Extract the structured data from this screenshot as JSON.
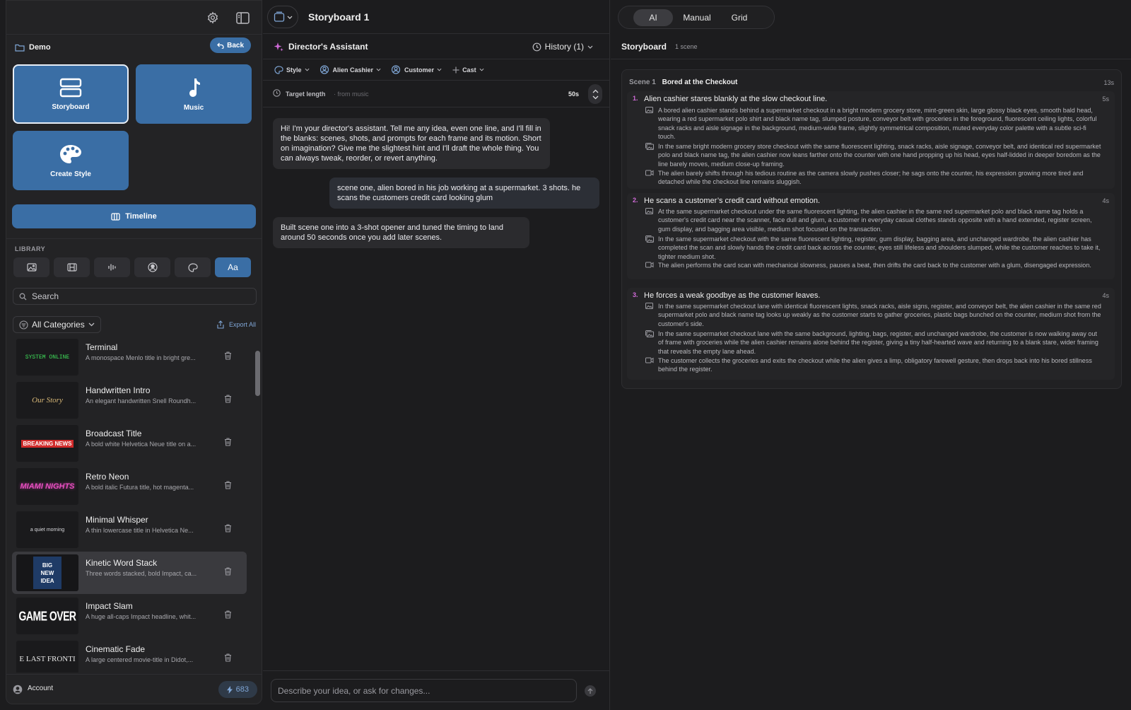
{
  "left": {
    "project_name": "Demo",
    "back_label": "Back",
    "tiles": {
      "storyboard": "Storyboard",
      "music": "Music",
      "create_style": "Create Style"
    },
    "timeline_label": "Timeline",
    "library_title": "LIBRARY",
    "library_tabs": [
      "image",
      "film",
      "audio",
      "character",
      "palette",
      "Aa"
    ],
    "search_placeholder": "Search",
    "categories_label": "All Categories",
    "export_label": "Export All",
    "items": [
      {
        "title": "Terminal",
        "desc": "A monospace Menlo title in bright gre...",
        "thumb": "SYSTEM ONLINE"
      },
      {
        "title": "Handwritten Intro",
        "desc": "An elegant handwritten Snell Roundh...",
        "thumb": "Our Story"
      },
      {
        "title": "Broadcast Title",
        "desc": "A bold white Helvetica Neue title on a...",
        "thumb": "BREAKING NEWS"
      },
      {
        "title": "Retro Neon",
        "desc": "A bold italic Futura title, hot magenta...",
        "thumb": "MIAMI NIGHTS"
      },
      {
        "title": "Minimal Whisper",
        "desc": "A thin lowercase title in Helvetica Ne...",
        "thumb": "a quiet morning"
      },
      {
        "title": "Kinetic Word Stack",
        "desc": "Three words stacked, bold Impact, ca...",
        "thumb": [
          "BIG",
          "NEW",
          "IDEA"
        ]
      },
      {
        "title": "Impact Slam",
        "desc": "A huge all-caps Impact headline, whit...",
        "thumb": "GAME OVER"
      },
      {
        "title": "Cinematic Fade",
        "desc": "A large centered movie-title in Didot,...",
        "thumb": "E LAST FRONTI"
      }
    ],
    "account_label": "Account",
    "credits": "683"
  },
  "middle": {
    "board_title": "Storyboard 1",
    "assistant_title": "Director's Assistant",
    "history_label": "History (1)",
    "chips": [
      "Style",
      "Alien Cashier",
      "Customer",
      "Cast"
    ],
    "target_label": "Target length",
    "target_from": "· from music",
    "target_value": "50s",
    "messages": [
      {
        "role": "assistant",
        "text": "Hi! I'm your director's assistant. Tell me any idea, even one line, and I'll fill in the blanks: scenes, shots, and prompts for each frame and its motion. Short on imagination? Give me the slightest hint and I'll draft the whole thing. You can always tweak, reorder, or revert anything."
      },
      {
        "role": "user",
        "text": "scene one, alien bored in his job working at a supermarket. 3 shots. he scans the customers credit card looking glum"
      },
      {
        "role": "assistant",
        "text": "Built scene one into a 3-shot opener and tuned the timing to land around 50 seconds once you add later scenes."
      }
    ],
    "composer_placeholder": "Describe your idea, or ask for changes..."
  },
  "right": {
    "modes": [
      "AI",
      "Manual",
      "Grid"
    ],
    "active_mode": "AI",
    "storyboard_title": "Storyboard",
    "scene_count": "1 scene",
    "scene": {
      "label": "Scene 1",
      "title": "Bored at the Checkout",
      "duration": "13s",
      "shots": [
        {
          "num": "1.",
          "title": "Alien cashier stares blankly at the slow checkout line.",
          "duration": "5s",
          "prompts": [
            {
              "icon": "image-icon",
              "text": "A bored alien cashier stands behind a supermarket checkout in a bright modern grocery store, mint-green skin, large glossy black eyes, smooth bald head, wearing a red supermarket polo shirt and black name tag, slumped posture, conveyor belt with groceries in the foreground, fluorescent ceiling lights, colorful snack racks and aisle signage in the background, medium-wide frame, slightly symmetrical composition, muted everyday color palette with a subtle sci-fi touch."
            },
            {
              "icon": "images-icon",
              "text": "In the same bright modern grocery store checkout with the same fluorescent lighting, snack racks, aisle signage, conveyor belt, and identical red supermarket polo and black name tag, the alien cashier now leans farther onto the counter with one hand propping up his head, eyes half-lidded in deeper boredom as the line barely moves, medium close-up framing."
            },
            {
              "icon": "video-icon",
              "text": "The alien barely shifts through his tedious routine as the camera slowly pushes closer; he sags onto the counter, his expression growing more tired and detached while the checkout line remains sluggish."
            }
          ]
        },
        {
          "num": "2.",
          "title": "He scans a customer’s credit card without emotion.",
          "duration": "4s",
          "prompts": [
            {
              "icon": "image-icon",
              "text": "At the same supermarket checkout under the same fluorescent lighting, the alien cashier in the same red supermarket polo and black name tag holds a customer's credit card near the scanner, face dull and glum, a customer in everyday casual clothes stands opposite with a hand extended, register screen, gum display, and bagging area visible, medium shot focused on the transaction."
            },
            {
              "icon": "images-icon",
              "text": "In the same supermarket checkout with the same fluorescent lighting, register, gum display, bagging area, and unchanged wardrobe, the alien cashier has completed the scan and slowly hands the credit card back across the counter, eyes still lifeless and shoulders slumped, while the customer reaches to take it, tighter medium shot."
            },
            {
              "icon": "video-icon",
              "text": "The alien performs the card scan with mechanical slowness, pauses a beat, then drifts the card back to the customer with a glum, disengaged expression."
            }
          ]
        },
        {
          "num": "3.",
          "title": "He forces a weak goodbye as the customer leaves.",
          "duration": "4s",
          "prompts": [
            {
              "icon": "image-icon",
              "text": "In the same supermarket checkout lane with identical fluorescent lights, snack racks, aisle signs, register, and conveyor belt, the alien cashier in the same red supermarket polo and black name tag looks up weakly as the customer starts to gather groceries, plastic bags bunched on the counter, medium shot from the customer's side."
            },
            {
              "icon": "images-icon",
              "text": "In the same supermarket checkout lane with the same background, lighting, bags, register, and unchanged wardrobe, the customer is now walking away out of frame with groceries while the alien cashier remains alone behind the register, giving a tiny half-hearted wave and returning to a blank stare, wider framing that reveals the empty lane ahead."
            },
            {
              "icon": "video-icon",
              "text": "The customer collects the groceries and exits the checkout while the alien gives a limp, obligatory farewell gesture, then drops back into his bored stillness behind the register."
            }
          ]
        }
      ]
    }
  },
  "colors": {
    "accent": "#3a6ea5",
    "shot_number": "#d16bd9",
    "background": "#1c1c1e"
  }
}
